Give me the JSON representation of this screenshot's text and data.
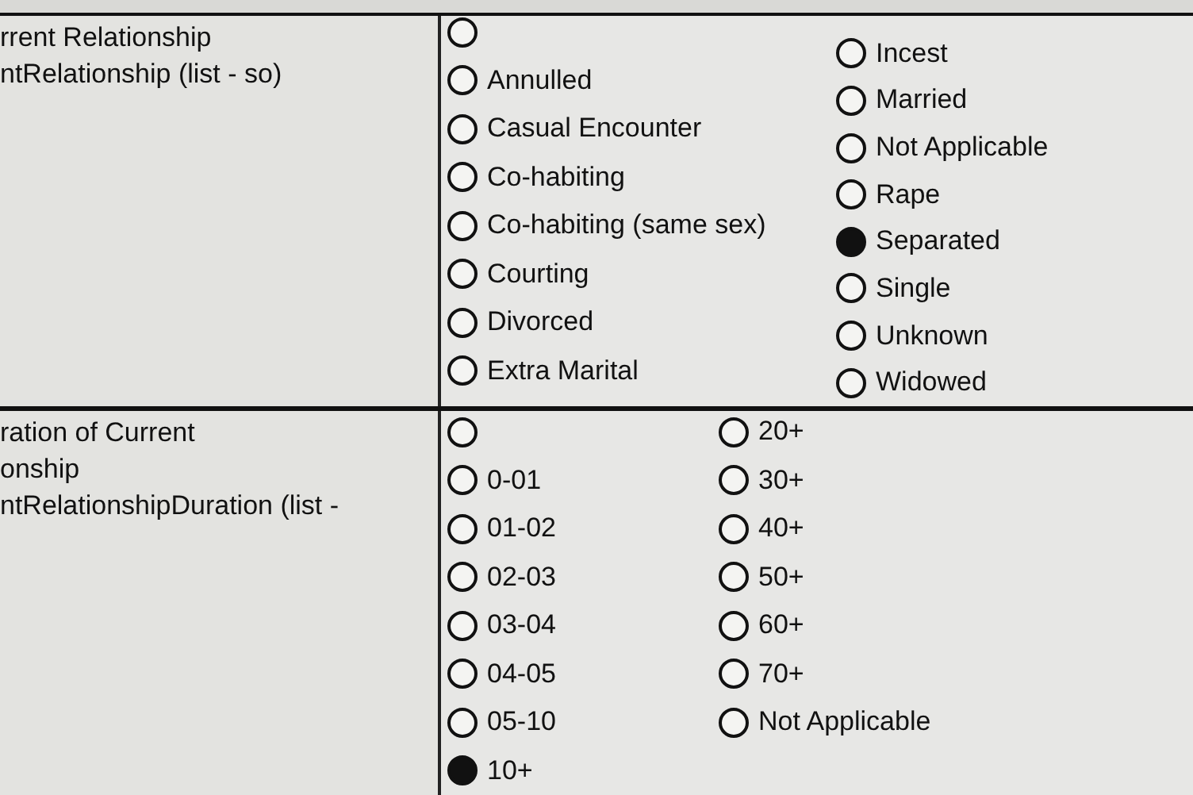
{
  "rows": [
    {
      "label_lines": [
        "rrent Relationship",
        "ntRelationship (list - so)"
      ],
      "columns": [
        [
          {
            "selected": false
          },
          {
            "label": "Annulled",
            "selected": false
          },
          {
            "label": "Casual Encounter",
            "selected": false
          },
          {
            "label": "Co-habiting",
            "selected": false
          },
          {
            "label": "Co-habiting (same sex)",
            "selected": false
          },
          {
            "label": "Courting",
            "selected": false
          },
          {
            "label": "Divorced",
            "selected": false
          },
          {
            "label": "Extra Marital",
            "selected": false
          }
        ],
        [
          {
            "label": "Incest",
            "selected": false
          },
          {
            "label": "Married",
            "selected": false
          },
          {
            "label": "Not Applicable",
            "selected": false
          },
          {
            "label": "Rape",
            "selected": false
          },
          {
            "label": "Separated",
            "selected": true
          },
          {
            "label": "Single",
            "selected": false
          },
          {
            "label": "Unknown",
            "selected": false
          },
          {
            "label": "Widowed",
            "selected": false
          }
        ]
      ]
    },
    {
      "label_lines": [
        "ration of Current",
        "onship",
        "ntRelationshipDuration (list -"
      ],
      "columns": [
        [
          {
            "selected": false
          },
          {
            "label": "0-01",
            "selected": false
          },
          {
            "label": "01-02",
            "selected": false
          },
          {
            "label": "02-03",
            "selected": false
          },
          {
            "label": "03-04",
            "selected": false
          },
          {
            "label": "04-05",
            "selected": false
          },
          {
            "label": "05-10",
            "selected": false
          },
          {
            "label": "10+",
            "selected": true
          }
        ],
        [
          {
            "label": "20+",
            "selected": false
          },
          {
            "label": "30+",
            "selected": false
          },
          {
            "label": "40+",
            "selected": false
          },
          {
            "label": "50+",
            "selected": false
          },
          {
            "label": "60+",
            "selected": false
          },
          {
            "label": "70+",
            "selected": false
          },
          {
            "label": "Not Applicable",
            "selected": false
          }
        ]
      ]
    }
  ]
}
